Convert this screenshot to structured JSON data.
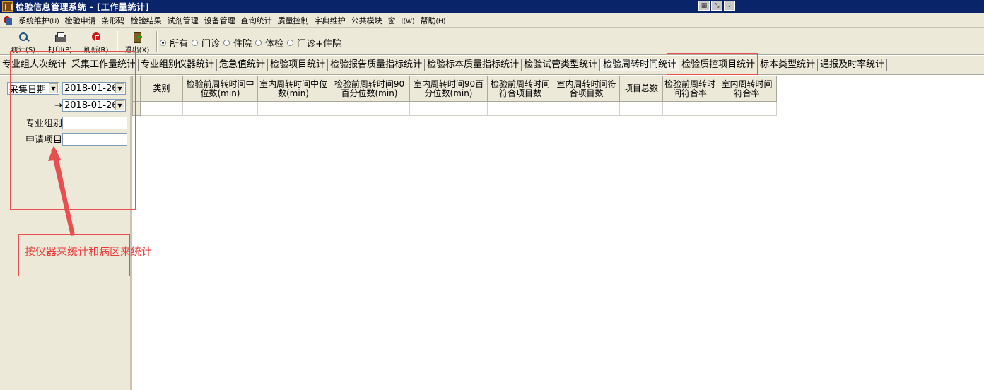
{
  "window": {
    "title": "检验信息管理系统 - [工作量统计]"
  },
  "menu": [
    {
      "label": "系统维护",
      "hotkey": "(U)"
    },
    {
      "label": "检验申请",
      "hotkey": ""
    },
    {
      "label": "条形码",
      "hotkey": ""
    },
    {
      "label": "检验结果",
      "hotkey": ""
    },
    {
      "label": "试剂管理",
      "hotkey": ""
    },
    {
      "label": "设备管理",
      "hotkey": ""
    },
    {
      "label": "查询统计",
      "hotkey": ""
    },
    {
      "label": "质量控制",
      "hotkey": ""
    },
    {
      "label": "字典维护",
      "hotkey": ""
    },
    {
      "label": "公共模块",
      "hotkey": ""
    },
    {
      "label": "窗口",
      "hotkey": "(W)"
    },
    {
      "label": "帮助",
      "hotkey": "(H)"
    }
  ],
  "toolbar": {
    "stats_label": "统计(S)",
    "print_label": "打印(P)",
    "refresh_label": "刷新(R)",
    "exit_label": "退出(X)",
    "radios": [
      {
        "label": "所有",
        "checked": true
      },
      {
        "label": "门诊",
        "checked": false
      },
      {
        "label": "住院",
        "checked": false
      },
      {
        "label": "体检",
        "checked": false
      },
      {
        "label": "门诊+住院",
        "checked": false
      }
    ]
  },
  "tabs": [
    {
      "label": "专业组人次统计",
      "active": false
    },
    {
      "label": "采集工作量统计",
      "active": false
    },
    {
      "label": "专业组别仪器统计",
      "active": false
    },
    {
      "label": "危急值统计",
      "active": false
    },
    {
      "label": "检验项目统计",
      "active": false
    },
    {
      "label": "检验报告质量指标统计",
      "active": false
    },
    {
      "label": "检验标本质量指标统计",
      "active": false
    },
    {
      "label": "检验试管类型统计",
      "active": false
    },
    {
      "label": "检验周转时间统计",
      "active": true
    },
    {
      "label": "检验质控项目统计",
      "active": false
    },
    {
      "label": "标本类型统计",
      "active": false
    },
    {
      "label": "通报及时率统计",
      "active": false
    }
  ],
  "filters": {
    "date_type": "采集日期",
    "date_from": "2018-01-26",
    "date_to_arrow": "→",
    "date_to": "2018-01-26",
    "group_label": "专业组别",
    "group_value": "",
    "item_label": "申请项目",
    "item_value": ""
  },
  "table": {
    "columns": [
      "类别",
      "检验前周转时间中位数(min)",
      "室内周转时间中位数(min)",
      "检验前周转时间90百分位数(min)",
      "室内周转时间90百分位数(min)",
      "检验前周转时间符合项目数",
      "室内周转时间符合项目数",
      "项目总数",
      "检验前周转时间符合率",
      "室内周转时间符合率"
    ]
  },
  "annotation": {
    "text": "按仪器来统计和病区来统计",
    "color": "#e83c3c"
  }
}
